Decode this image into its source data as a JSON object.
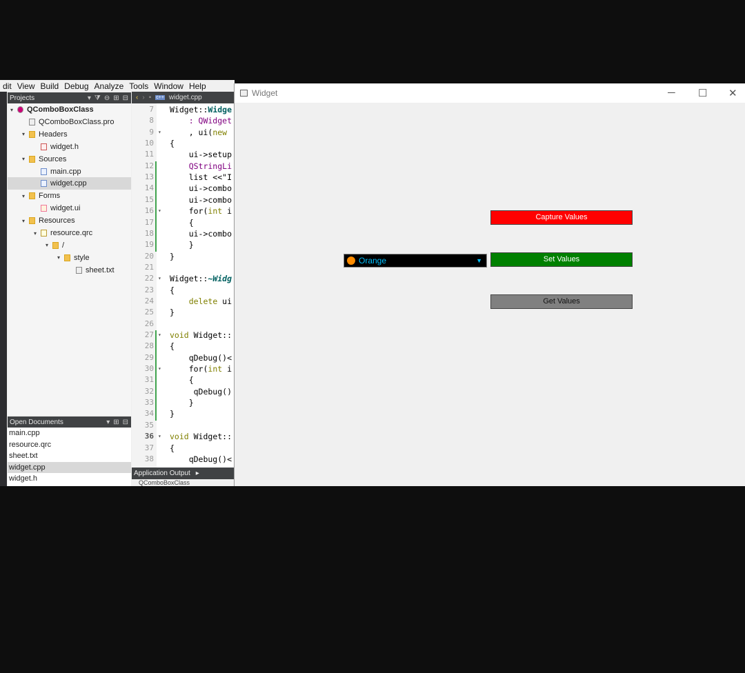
{
  "menu": [
    "dit",
    "View",
    "Build",
    "Debug",
    "Analyze",
    "Tools",
    "Window",
    "Help"
  ],
  "projects_panel": {
    "title": "Projects",
    "tree": [
      {
        "label": "QComboBoxClass",
        "bold": true,
        "depth": 0,
        "expanded": true,
        "icon": "project-icon"
      },
      {
        "label": "QComboBoxClass.pro",
        "depth": 1,
        "icon": "file-icon"
      },
      {
        "label": "Headers",
        "depth": 1,
        "expanded": true,
        "icon": "folder-icon"
      },
      {
        "label": "widget.h",
        "depth": 2,
        "icon": "header-file-icon"
      },
      {
        "label": "Sources",
        "depth": 1,
        "expanded": true,
        "icon": "folder-icon"
      },
      {
        "label": "main.cpp",
        "depth": 2,
        "icon": "cpp-file-icon"
      },
      {
        "label": "widget.cpp",
        "depth": 2,
        "selected": true,
        "icon": "cpp-file-icon"
      },
      {
        "label": "Forms",
        "depth": 1,
        "expanded": true,
        "icon": "folder-icon"
      },
      {
        "label": "widget.ui",
        "depth": 2,
        "icon": "ui-file-icon"
      },
      {
        "label": "Resources",
        "depth": 1,
        "expanded": true,
        "icon": "folder-icon"
      },
      {
        "label": "resource.qrc",
        "depth": 2,
        "expanded": true,
        "icon": "qrc-file-icon"
      },
      {
        "label": "/",
        "depth": 3,
        "expanded": true,
        "icon": "folder-icon"
      },
      {
        "label": "style",
        "depth": 4,
        "expanded": true,
        "icon": "folder-icon"
      },
      {
        "label": "sheet.txt",
        "depth": 5,
        "icon": "text-file-icon"
      }
    ]
  },
  "open_documents": {
    "title": "Open Documents",
    "items": [
      {
        "label": "main.cpp"
      },
      {
        "label": "resource.qrc"
      },
      {
        "label": "sheet.txt"
      },
      {
        "label": "widget.cpp",
        "selected": true
      },
      {
        "label": "widget.h"
      }
    ]
  },
  "editor": {
    "tab": "widget.cpp",
    "lines": [
      {
        "n": "7",
        "text": "Widget::Widge"
      },
      {
        "n": "8",
        "text": "    : QWidget"
      },
      {
        "n": "9",
        "text": "    , ui(new ",
        "fold": true
      },
      {
        "n": "10",
        "text": "{"
      },
      {
        "n": "11",
        "text": "    ui->setup"
      },
      {
        "n": "12",
        "text": "    QStringLi"
      },
      {
        "n": "13",
        "text": "    list <<\"I"
      },
      {
        "n": "14",
        "text": "    ui->combo"
      },
      {
        "n": "15",
        "text": "    ui->combo"
      },
      {
        "n": "16",
        "text": "    for(int i",
        "fold": true
      },
      {
        "n": "17",
        "text": "    {"
      },
      {
        "n": "18",
        "text": "    ui->combo"
      },
      {
        "n": "19",
        "text": "    }"
      },
      {
        "n": "20",
        "text": "}"
      },
      {
        "n": "21",
        "text": ""
      },
      {
        "n": "22",
        "text": "Widget::~Widg",
        "fold": true
      },
      {
        "n": "23",
        "text": "{"
      },
      {
        "n": "24",
        "text": "    delete ui"
      },
      {
        "n": "25",
        "text": "}"
      },
      {
        "n": "26",
        "text": ""
      },
      {
        "n": "27",
        "text": "void Widget::",
        "fold": true
      },
      {
        "n": "28",
        "text": "{"
      },
      {
        "n": "29",
        "text": "    qDebug()<"
      },
      {
        "n": "30",
        "text": "    for(int i",
        "fold": true
      },
      {
        "n": "31",
        "text": "    {"
      },
      {
        "n": "32",
        "text": "     qDebug()"
      },
      {
        "n": "33",
        "text": "    }"
      },
      {
        "n": "34",
        "text": "}"
      },
      {
        "n": "35",
        "text": ""
      },
      {
        "n": "36",
        "text": "void Widget::",
        "fold": true,
        "bold": true
      },
      {
        "n": "37",
        "text": "{"
      },
      {
        "n": "38",
        "text": "    qDebug()<"
      }
    ]
  },
  "app_output": {
    "title": "Application Output",
    "tab": "QComboBoxClass"
  },
  "widget_window": {
    "title": "Widget",
    "minimize": "─",
    "maximize": "☐",
    "close": "✕",
    "capture_button": "Capture Values",
    "set_button": "Set Values",
    "get_button": "Get Values",
    "combo_value": "Orange",
    "combo_icon": "orange-fruit-icon",
    "capture_color": "#ff0000",
    "set_color": "#008000",
    "get_color": "#808080"
  }
}
